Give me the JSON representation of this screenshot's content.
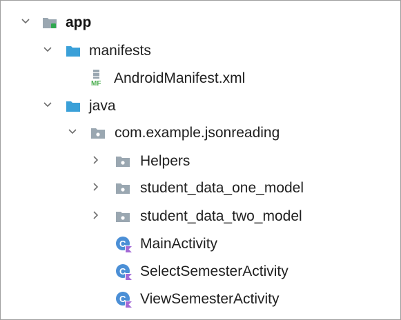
{
  "project_tree": {
    "rows": [
      {
        "label": "app",
        "icon": "module-folder-icon",
        "chevron": "expanded"
      },
      {
        "label": "manifests",
        "icon": "folder-icon",
        "chevron": "expanded"
      },
      {
        "label": "AndroidManifest.xml",
        "icon": "manifest-file-icon",
        "icon_text": "MF",
        "chevron": "none"
      },
      {
        "label": "java",
        "icon": "folder-icon",
        "chevron": "expanded"
      },
      {
        "label": "com.example.jsonreading",
        "icon": "package-icon",
        "chevron": "expanded"
      },
      {
        "label": "Helpers",
        "icon": "package-icon",
        "chevron": "collapsed"
      },
      {
        "label": "student_data_one_model",
        "icon": "package-icon",
        "chevron": "collapsed"
      },
      {
        "label": "student_data_two_model",
        "icon": "package-icon",
        "chevron": "collapsed"
      },
      {
        "label": "MainActivity",
        "icon": "kotlin-class-icon",
        "chevron": "none"
      },
      {
        "label": "SelectSemesterActivity",
        "icon": "kotlin-class-icon",
        "chevron": "none"
      },
      {
        "label": "ViewSemesterActivity",
        "icon": "kotlin-class-icon",
        "chevron": "none"
      }
    ]
  },
  "colors": {
    "folder": "#3aa0d8",
    "package": "#9aa7b1",
    "chevron": "#6e6e6e",
    "manifest_green": "#4caf50",
    "kotlin_purple": "#a46ad6",
    "class_blue": "#4b8fd6"
  }
}
